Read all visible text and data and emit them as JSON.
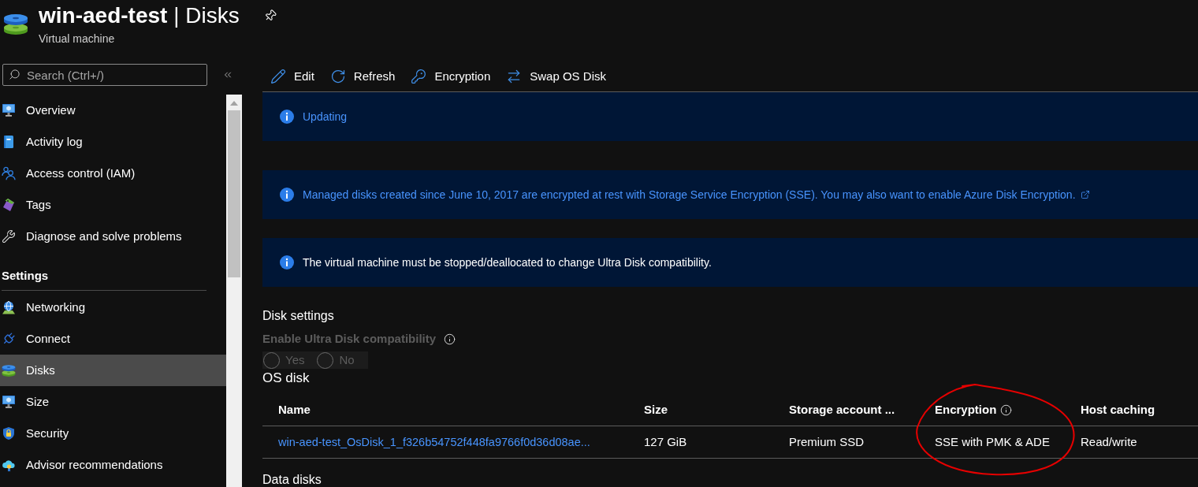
{
  "header": {
    "title": "**win-aed-test** | Disks",
    "subtitle": "Virtual machine"
  },
  "sidebar": {
    "search": {
      "placeholder": "Search (Ctrl+/)"
    },
    "groups": [
      {
        "items": [
          {
            "label": "Overview",
            "selected": false
          },
          {
            "label": "Activity log",
            "selected": false
          },
          {
            "label": "Access control (IAM)",
            "selected": false
          },
          {
            "label": "Tags",
            "selected": false
          },
          {
            "label": "Diagnose and solve problems",
            "selected": false
          }
        ]
      },
      {
        "heading": "Settings",
        "items": [
          {
            "label": "Networking",
            "selected": false
          },
          {
            "label": "Connect",
            "selected": false
          },
          {
            "label": "Disks",
            "selected": true
          },
          {
            "label": "Size",
            "selected": false
          },
          {
            "label": "Security",
            "selected": false
          },
          {
            "label": "Advisor recommendations",
            "selected": false
          }
        ]
      }
    ]
  },
  "toolbar": [
    {
      "label": "Edit"
    },
    {
      "label": "Refresh"
    },
    {
      "label": "Encryption"
    },
    {
      "label": "Swap OS Disk"
    }
  ],
  "banners": [
    {
      "kind": "status",
      "text": "Updating"
    },
    {
      "kind": "external-link",
      "text": "Managed disks created since June 10, 2017 are encrypted at rest with Storage Service Encryption (SSE). You may also want to enable Azure Disk Encryption."
    },
    {
      "kind": "message",
      "text": "The virtual machine must be stopped/deallocated to change Ultra Disk compatibility."
    }
  ],
  "disk_settings": {
    "heading": "Disk settings",
    "ultra_disk": {
      "label": "Enable Ultra Disk compatibility",
      "disabled": true,
      "options": [
        {
          "label": "Yes",
          "selected": false
        },
        {
          "label": "No",
          "selected": false
        }
      ]
    }
  },
  "os_disk": {
    "heading": "OS disk",
    "columns": [
      {
        "label": "Name",
        "info": false,
        "circled": false
      },
      {
        "label": "Size",
        "info": false,
        "circled": false
      },
      {
        "label": "Storage account ...",
        "info": false,
        "circled": false
      },
      {
        "label": "Encryption",
        "info": true,
        "circled": true
      },
      {
        "label": "Host caching",
        "info": false,
        "circled": false
      }
    ],
    "rows": [
      {
        "cells": [
          {
            "kind": "link",
            "text": "win-aed-test_OsDisk_1_f326b54752f448fa9766f0d36d08ae..."
          },
          {
            "kind": "text",
            "text": "127 GiB"
          },
          {
            "kind": "text",
            "text": "Premium SSD"
          },
          {
            "kind": "text",
            "text": "SSE with PMK & ADE"
          },
          {
            "kind": "text",
            "text": "Read/write"
          }
        ]
      }
    ]
  },
  "data_disks": {
    "heading": "Data disks"
  }
}
